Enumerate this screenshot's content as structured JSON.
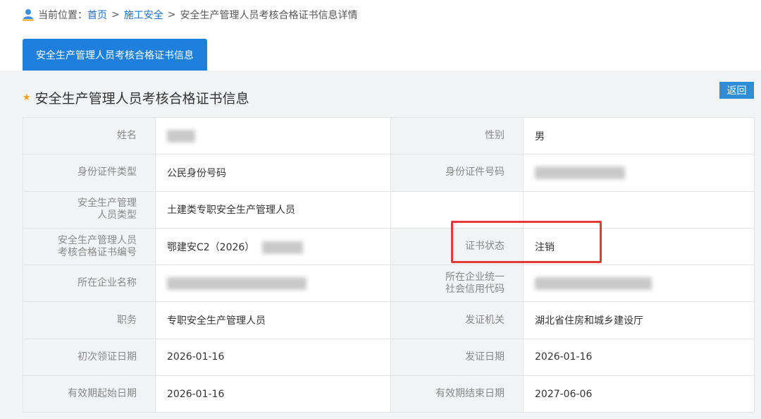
{
  "breadcrumb": {
    "prefix": "当前位置：",
    "home": "首页",
    "section": "施工安全",
    "current": "安全生产管理人员考核合格证书信息详情",
    "separator": ">"
  },
  "tab": {
    "label": "安全生产管理人员考核合格证书信息"
  },
  "panel": {
    "title": "安全生产管理人员考核合格证书信息",
    "back_label": "返回"
  },
  "fields": {
    "name": {
      "label": "姓名"
    },
    "gender": {
      "label": "性别",
      "value": "男"
    },
    "id_type": {
      "label": "身份证件类型",
      "value": "公民身份号码"
    },
    "id_number": {
      "label": "身份证件号码"
    },
    "person_type": {
      "label_line1": "安全生产管理",
      "label_line2": "人员类型",
      "value": "土建类专职安全生产管理人员"
    },
    "cert_number": {
      "label_line1": "安全生产管理人员",
      "label_line2": "考核合格证书编号",
      "value": "鄂建安C2（2026）"
    },
    "cert_status": {
      "label": "证书状态",
      "value": "注销"
    },
    "company_name": {
      "label": "所在企业名称"
    },
    "credit_code": {
      "label_line1": "所在企业统一",
      "label_line2": "社会信用代码"
    },
    "position": {
      "label": "职务",
      "value": "专职安全生产管理人员"
    },
    "issuer": {
      "label": "发证机关",
      "value": "湖北省住房和城乡建设厅"
    },
    "first_issue_date": {
      "label": "初次领证日期",
      "value": "2026-01-16"
    },
    "issue_date": {
      "label": "发证日期",
      "value": "2026-01-16"
    },
    "valid_from": {
      "label": "有效期起始日期",
      "value": "2026-01-16"
    },
    "valid_to": {
      "label": "有效期结束日期",
      "value": "2027-06-06"
    }
  },
  "colors": {
    "link": "#1e6fc5",
    "tab_bg": "#1f7fdc",
    "back_button_bg": "#2f8dd6",
    "star": "#f0a30a",
    "highlight_border": "#e03a3a",
    "label_bg": "#f2f3f5"
  },
  "icons": {
    "breadcrumb": "user-location-icon",
    "title": "star-icon"
  }
}
